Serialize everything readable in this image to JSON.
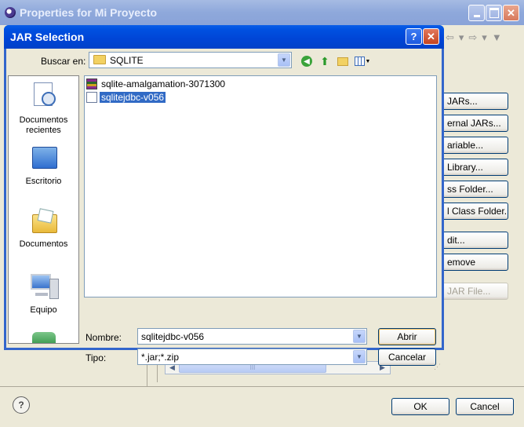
{
  "outer_window": {
    "title": "Properties for Mi Proyecto",
    "buttons": [
      {
        "label": "JARs...",
        "disabled": false
      },
      {
        "label": "ernal JARs...",
        "disabled": false
      },
      {
        "label": "ariable...",
        "disabled": false
      },
      {
        "label": "Library...",
        "disabled": false
      },
      {
        "label": "ss Folder...",
        "disabled": false
      },
      {
        "label": "l Class Folder...",
        "disabled": false
      },
      {
        "label": "dit...",
        "disabled": false
      },
      {
        "label": "emove",
        "disabled": false
      },
      {
        "label": "JAR File...",
        "disabled": true
      }
    ],
    "ok_label": "OK",
    "cancel_label": "Cancel",
    "help_glyph": "?",
    "scroll_thumb_glyph": "III"
  },
  "jar_dialog": {
    "title": "JAR Selection",
    "help_glyph": "?",
    "close_glyph": "✕",
    "look_in_label": "Buscar en:",
    "look_in_value": "SQLITE",
    "places": [
      {
        "label": "Documentos recientes",
        "icon": "recent-documents-icon"
      },
      {
        "label": "Escritorio",
        "icon": "desktop-icon"
      },
      {
        "label": "Documentos",
        "icon": "documents-folder-icon"
      },
      {
        "label": "Equipo",
        "icon": "computer-icon"
      }
    ],
    "files": [
      {
        "name": "sqlite-amalgamation-3071300",
        "icon": "archive-icon",
        "selected": false
      },
      {
        "name": "sqlitejdbc-v056",
        "icon": "jar-file-icon",
        "selected": true
      }
    ],
    "name_label": "Nombre:",
    "name_value": "sqlitejdbc-v056",
    "type_label": "Tipo:",
    "type_value": "*.jar;*.zip",
    "open_label": "Abrir",
    "cancel_label": "Cancelar"
  }
}
